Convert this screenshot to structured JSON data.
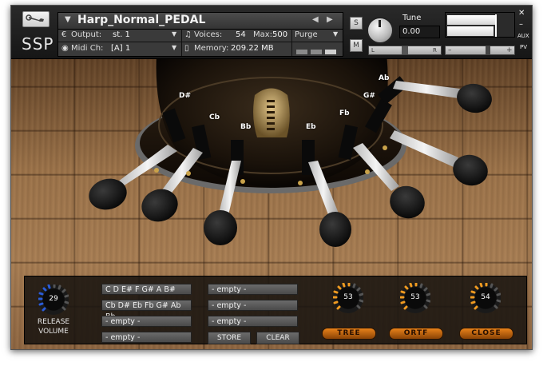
{
  "instrument": {
    "brand": "SSP",
    "name": "Harp_Normal_PEDAL",
    "output_label": "Output:",
    "output_value": "st. 1",
    "voices_label": "Voices:",
    "voices_value": "54",
    "max_label": "Max:",
    "max_value": "500",
    "purge_label": "Purge",
    "midi_label": "Midi Ch:",
    "midi_value": "[A] 1",
    "memory_label": "Memory:",
    "memory_value": "209.22 MB",
    "tune_label": "Tune",
    "tune_value": "0.00",
    "s_label": "S",
    "m_label": "M",
    "pan_left": "L",
    "pan_right": "R",
    "vol_minus": "–",
    "vol_plus": "+",
    "aux_label": "AUX",
    "pv_label": "PV"
  },
  "notes": [
    "D#",
    "Cb",
    "Bb",
    "Eb",
    "Fb",
    "G#",
    "Ab"
  ],
  "release": {
    "value": "29",
    "label_1": "RELEASE",
    "label_2": "VOLUME"
  },
  "presets": {
    "col1": [
      "C D E# F G# A B#",
      "Cb D# Eb Fb G# Ab Bb",
      "- empty -",
      "- empty -"
    ],
    "col2": [
      "- empty -",
      "- empty -",
      "- empty -"
    ],
    "store": "STORE",
    "clear": "CLEAR"
  },
  "mics": [
    {
      "label": "TREE",
      "value": "53"
    },
    {
      "label": "ORTF",
      "value": "53"
    },
    {
      "label": "CLOSE",
      "value": "54"
    }
  ],
  "colors": {
    "accent_orange": "#e8821a",
    "release_blue": "#2a5cd8"
  }
}
